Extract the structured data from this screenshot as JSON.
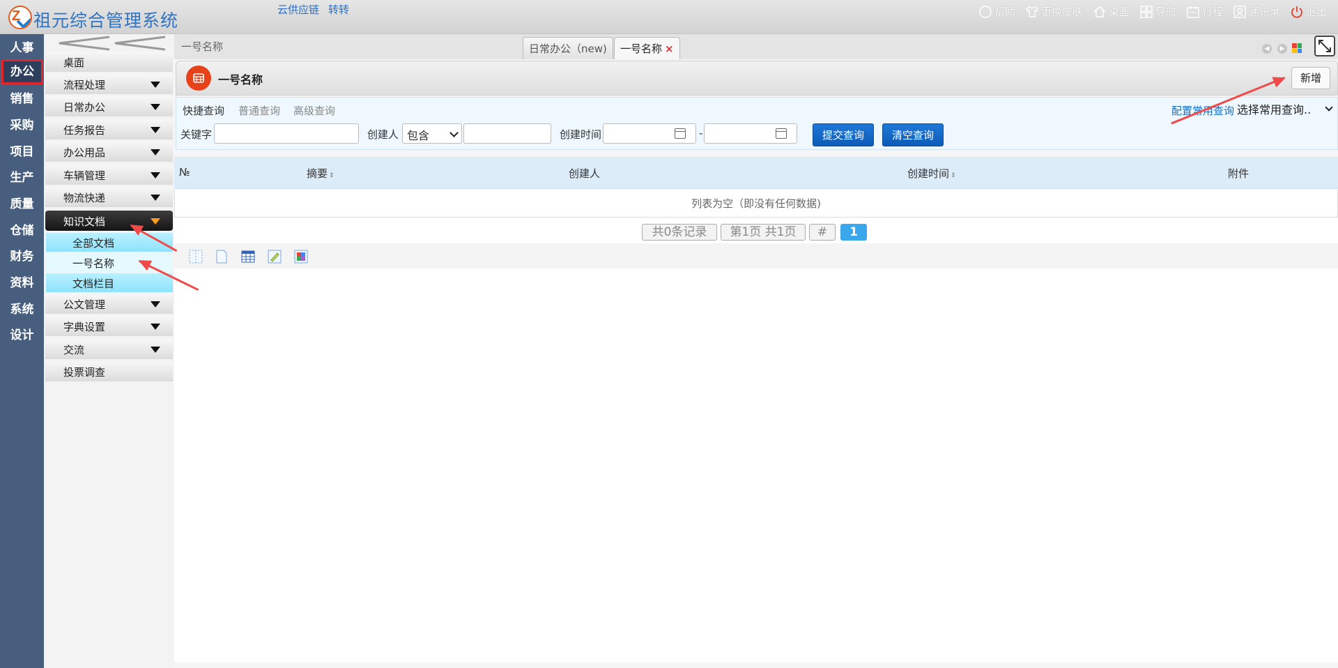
{
  "header": {
    "app_title": "祖元综合管理系统",
    "links": [
      "云供应链",
      "转转"
    ],
    "toolbar": [
      {
        "label": "帮助",
        "icon": "help-icon"
      },
      {
        "label": "更换皮肤",
        "icon": "shirt-icon"
      },
      {
        "label": "桌面",
        "icon": "home-icon"
      },
      {
        "label": "导航",
        "icon": "grid-icon"
      },
      {
        "label": "行程",
        "icon": "calendar-icon"
      },
      {
        "label": "通讯录",
        "icon": "contacts-icon"
      },
      {
        "label": "退出",
        "icon": "power-icon"
      }
    ]
  },
  "rail": {
    "items": [
      "人事",
      "办公",
      "销售",
      "采购",
      "项目",
      "生产",
      "质量",
      "仓储",
      "财务",
      "资料",
      "系统",
      "设计"
    ],
    "active_index": 1
  },
  "menu": {
    "collapse_icon": "double-chevron-left-icon",
    "items": [
      {
        "label": "桌面",
        "has_children": false
      },
      {
        "label": "流程处理",
        "has_children": true
      },
      {
        "label": "日常办公",
        "has_children": true
      },
      {
        "label": "任务报告",
        "has_children": true
      },
      {
        "label": "办公用品",
        "has_children": true
      },
      {
        "label": "车辆管理",
        "has_children": true
      },
      {
        "label": "物流快递",
        "has_children": true
      },
      {
        "label": "知识文档",
        "has_children": true,
        "open": true
      },
      {
        "label": "公文管理",
        "has_children": true
      },
      {
        "label": "字典设置",
        "has_children": true
      },
      {
        "label": "交流",
        "has_children": true
      },
      {
        "label": "投票调查",
        "has_children": false
      }
    ],
    "sub_items": [
      "全部文档",
      "一号名称",
      "文档栏目"
    ],
    "selected_sub": 1
  },
  "tabs": {
    "breadcrumb": "一号名称",
    "items": [
      {
        "label": "日常办公（new)",
        "active": false
      },
      {
        "label": "一号名称",
        "active": true,
        "closable": true
      }
    ],
    "close_glyph": "×"
  },
  "page": {
    "title": "一号名称",
    "add_label": "新增"
  },
  "query": {
    "tabs": [
      "快捷查询",
      "普通查询",
      "高级查询"
    ],
    "keyword_label": "关键字",
    "keyword_value": "",
    "creator_label": "创建人",
    "creator_op": "包含",
    "creator_value": "",
    "time_label": "创建时间",
    "time_from": "",
    "time_to": "",
    "range_sep": "-",
    "submit_label": "提交查询",
    "clear_label": "清空查询",
    "config_link": "配置常用查询",
    "common_select": "选择常用查询.."
  },
  "table": {
    "columns": [
      {
        "label": "№",
        "sortable": false
      },
      {
        "label": "摘要",
        "sortable": true
      },
      {
        "label": "创建人",
        "sortable": false
      },
      {
        "label": "创建时间",
        "sortable": true
      },
      {
        "label": "附件",
        "sortable": false
      }
    ],
    "empty_text": "列表为空（即没有任何数据)",
    "sort_glyph": "⇕"
  },
  "pager": {
    "total": "共0条记录",
    "page_info": "第1页 共1页",
    "jump": "#",
    "current": "1"
  },
  "tools": [
    "dotted-box-icon",
    "document-icon",
    "table-icon",
    "edit-icon",
    "puzzle-icon"
  ],
  "colors": {
    "rail_bg": "#485e7e",
    "accent_blue": "#1f78d6",
    "active_border": "#e2262b",
    "annotation_arrow": "#f04a4a"
  }
}
